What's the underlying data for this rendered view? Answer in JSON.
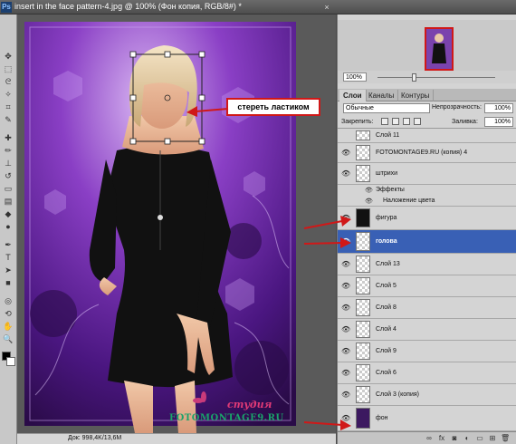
{
  "window": {
    "logo": "Ps",
    "title": "insert in the face pattern-4.jpg @ 100% (Фон копия, RGB/8#) *",
    "close_glyph": "×"
  },
  "callout": {
    "text": "стереть ластиком"
  },
  "watermark": {
    "line1": "студия",
    "line2": "FOTOMONTAGE9.RU"
  },
  "status": {
    "doc_text": "Док: 998,4K/13,6M"
  },
  "navigator": {
    "zoom": "100%"
  },
  "layers_panel": {
    "tabs": [
      "Слои",
      "Каналы",
      "Контуры"
    ],
    "active_tab": 0,
    "blend_mode": "Обычные",
    "opacity_label": "Непрозрачность:",
    "opacity_value": "100%",
    "lock_label": "Закрепить:",
    "fill_label": "Заливка:",
    "fill_value": "100%",
    "layers": [
      {
        "name": "Слой 11",
        "visible": false,
        "thumb": "checker",
        "selected": false
      },
      {
        "name": "FOTOMONTAGE9.RU (копия) 4",
        "visible": true,
        "thumb": "checker",
        "selected": false
      },
      {
        "name": "штрихи",
        "visible": true,
        "thumb": "checker",
        "selected": false
      },
      {
        "name": "Эффекты",
        "type": "effects-header"
      },
      {
        "name": "Наложение цвета",
        "type": "effect"
      },
      {
        "name": "фигура",
        "visible": true,
        "thumb": "dark",
        "selected": false
      },
      {
        "name": "голова",
        "visible": true,
        "thumb": "checker",
        "selected": true
      },
      {
        "name": "Слой 13",
        "visible": true,
        "thumb": "checker",
        "selected": false
      },
      {
        "name": "Слой 5",
        "visible": true,
        "thumb": "checker",
        "selected": false
      },
      {
        "name": "Слой 8",
        "visible": true,
        "thumb": "checker",
        "selected": false
      },
      {
        "name": "Слой 4",
        "visible": true,
        "thumb": "checker",
        "selected": false
      },
      {
        "name": "Слой 9",
        "visible": true,
        "thumb": "checker",
        "selected": false
      },
      {
        "name": "Слой 6",
        "visible": true,
        "thumb": "checker",
        "selected": false
      },
      {
        "name": "Слой 3 (копия)",
        "visible": true,
        "thumb": "checker",
        "selected": false
      },
      {
        "name": "фон",
        "visible": true,
        "thumb": "purple",
        "selected": false
      }
    ]
  },
  "colors": {
    "accent_selected": "#3960b5",
    "callout_border": "#d01818",
    "arrow": "#d01818"
  }
}
